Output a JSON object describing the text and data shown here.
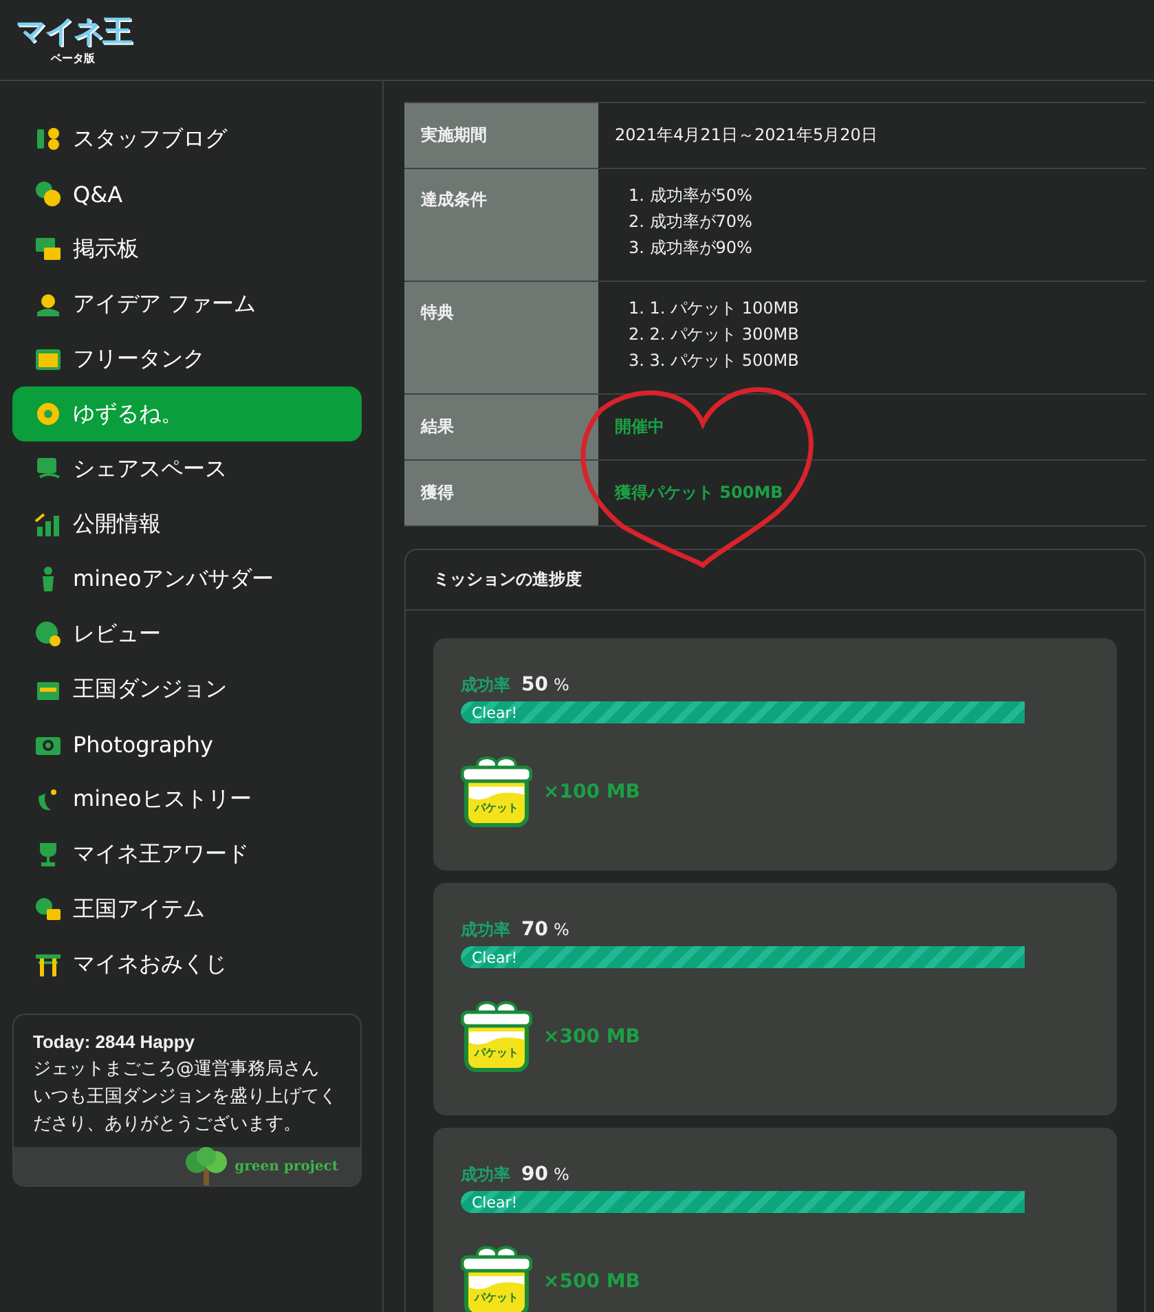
{
  "logo": {
    "title": "マイネ王",
    "subtitle": "ベータ版"
  },
  "sidebar": {
    "items": [
      {
        "label": "スタッフブログ",
        "selected": false
      },
      {
        "label": "Q&A",
        "selected": false
      },
      {
        "label": "掲示板",
        "selected": false
      },
      {
        "label": "アイデア ファーム",
        "selected": false
      },
      {
        "label": "フリータンク",
        "selected": false
      },
      {
        "label": "ゆずるね。",
        "selected": true
      },
      {
        "label": "シェアスペース",
        "selected": false
      },
      {
        "label": "公開情報",
        "selected": false
      },
      {
        "label": "mineoアンバサダー",
        "selected": false
      },
      {
        "label": "レビュー",
        "selected": false
      },
      {
        "label": "王国ダンジョン",
        "selected": false
      },
      {
        "label": "Photography",
        "selected": false
      },
      {
        "label": "mineoヒストリー",
        "selected": false
      },
      {
        "label": "マイネ王アワード",
        "selected": false
      },
      {
        "label": "王国アイテム",
        "selected": false
      },
      {
        "label": "マイネおみくじ",
        "selected": false
      }
    ],
    "today": {
      "title": "Today: 2844 Happy",
      "lines": [
        "ジェットまごころ@運営事務局さん",
        "いつも王国ダンジョンを盛り上げてくださり、ありがとうございます。"
      ],
      "footer": "green project"
    }
  },
  "details": [
    {
      "label": "実施期間",
      "kind": "text",
      "value": "2021年4月21日～2021年5月20日"
    },
    {
      "label": "達成条件",
      "kind": "list",
      "items": [
        {
          "marker": "1.",
          "text": "成功率が50%"
        },
        {
          "marker": "2.",
          "text": "成功率が70%"
        },
        {
          "marker": "3.",
          "text": "成功率が90%"
        }
      ]
    },
    {
      "label": "特典",
      "kind": "list",
      "items": [
        {
          "marker": "1.",
          "text": "1. パケット 100MB"
        },
        {
          "marker": "2.",
          "text": "2. パケット 300MB"
        },
        {
          "marker": "3.",
          "text": "3. パケット 500MB"
        }
      ]
    },
    {
      "label": "結果",
      "kind": "highlight",
      "value": "開催中"
    },
    {
      "label": "獲得",
      "kind": "highlight",
      "value": "獲得パケット 500MB"
    }
  ],
  "missions": {
    "title": "ミッションの進捗度",
    "items": [
      {
        "rate_label": "成功率",
        "rate": "50",
        "unit": "%",
        "bar_text": "Clear!",
        "gift_label": "パケット",
        "reward": "×100 MB"
      },
      {
        "rate_label": "成功率",
        "rate": "70",
        "unit": "%",
        "bar_text": "Clear!",
        "gift_label": "パケット",
        "reward": "×300 MB"
      },
      {
        "rate_label": "成功率",
        "rate": "90",
        "unit": "%",
        "bar_text": "Clear!",
        "gift_label": "パケット",
        "reward": "×500 MB"
      }
    ]
  }
}
